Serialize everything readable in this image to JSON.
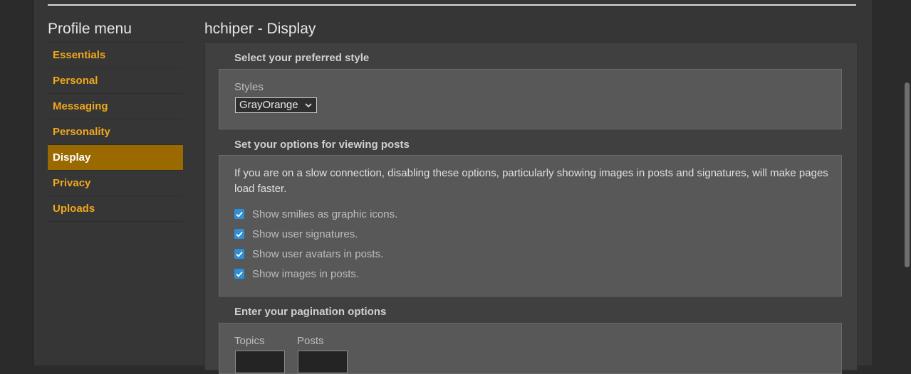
{
  "sidebar": {
    "title": "Profile menu",
    "items": [
      {
        "label": "Essentials"
      },
      {
        "label": "Personal"
      },
      {
        "label": "Messaging"
      },
      {
        "label": "Personality"
      },
      {
        "label": "Display",
        "active": true
      },
      {
        "label": "Privacy"
      },
      {
        "label": "Uploads"
      }
    ]
  },
  "main": {
    "title": "hchiper - Display",
    "style_section": {
      "heading": "Select your preferred style",
      "styles_label": "Styles",
      "styles_value": "GrayOrange"
    },
    "posts_section": {
      "heading": "Set your options for viewing posts",
      "description": "If you are on a slow connection, disabling these options, particularly showing images in posts and signatures, will make pages load faster.",
      "options": [
        {
          "label": "Show smilies as graphic icons.",
          "checked": true
        },
        {
          "label": "Show user signatures.",
          "checked": true
        },
        {
          "label": "Show user avatars in posts.",
          "checked": true
        },
        {
          "label": "Show images in posts.",
          "checked": true
        }
      ]
    },
    "pagination_section": {
      "heading": "Enter your pagination options",
      "topics_label": "Topics",
      "posts_label": "Posts"
    }
  },
  "colors": {
    "accent": "#f0a81c",
    "active_bg": "#9a6a00",
    "checkbox": "#2f8fd6"
  }
}
